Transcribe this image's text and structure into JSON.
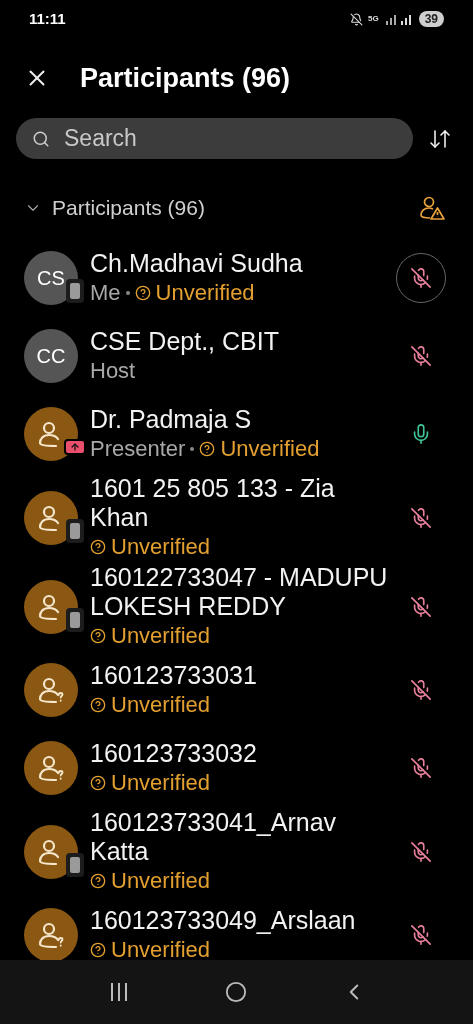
{
  "status_bar": {
    "time": "11:11",
    "network": "5G",
    "battery": "39"
  },
  "header": {
    "title": "Participants (96)"
  },
  "search": {
    "placeholder": "Search"
  },
  "section": {
    "title": "Participants (96)",
    "expanded": true
  },
  "participants": [
    {
      "name": "Ch.Madhavi Sudha",
      "avatar": {
        "kind": "initials",
        "text": "CS"
      },
      "badge": {
        "kind": "mobile"
      },
      "role": "Me",
      "status": "Unverified",
      "muted": true,
      "mic_outlined": true
    },
    {
      "name": "CSE Dept., CBIT",
      "avatar": {
        "kind": "initials",
        "text": "CC"
      },
      "role": "Host",
      "muted": true,
      "mic_outlined": false
    },
    {
      "name": "Dr. Padmaja S",
      "avatar": {
        "kind": "person"
      },
      "badge": {
        "kind": "sharing"
      },
      "role": "Presenter",
      "status": "Unverified",
      "muted": false,
      "mic_outlined": false
    },
    {
      "name": "1601 25 805 133 - Zia Khan",
      "avatar": {
        "kind": "person"
      },
      "badge": {
        "kind": "mobile"
      },
      "status": "Unverified",
      "muted": true,
      "mic_outlined": false
    },
    {
      "name": "160122733047 - MADUPU LOKESH REDDY",
      "avatar": {
        "kind": "person"
      },
      "badge": {
        "kind": "mobile"
      },
      "status": "Unverified",
      "muted": true,
      "mic_outlined": false
    },
    {
      "name": "160123733031",
      "avatar": {
        "kind": "person"
      },
      "badge": {
        "kind": "guest"
      },
      "status": "Unverified",
      "muted": true,
      "mic_outlined": false
    },
    {
      "name": "160123733032",
      "avatar": {
        "kind": "person"
      },
      "badge": {
        "kind": "guest"
      },
      "status": "Unverified",
      "muted": true,
      "mic_outlined": false
    },
    {
      "name": "160123733041_Arnav Katta",
      "avatar": {
        "kind": "person"
      },
      "badge": {
        "kind": "mobile"
      },
      "status": "Unverified",
      "muted": true,
      "mic_outlined": false
    },
    {
      "name": "160123733049_Arslaan",
      "avatar": {
        "kind": "person"
      },
      "badge": {
        "kind": "guest"
      },
      "status": "Unverified",
      "muted": true,
      "mic_outlined": false
    }
  ]
}
